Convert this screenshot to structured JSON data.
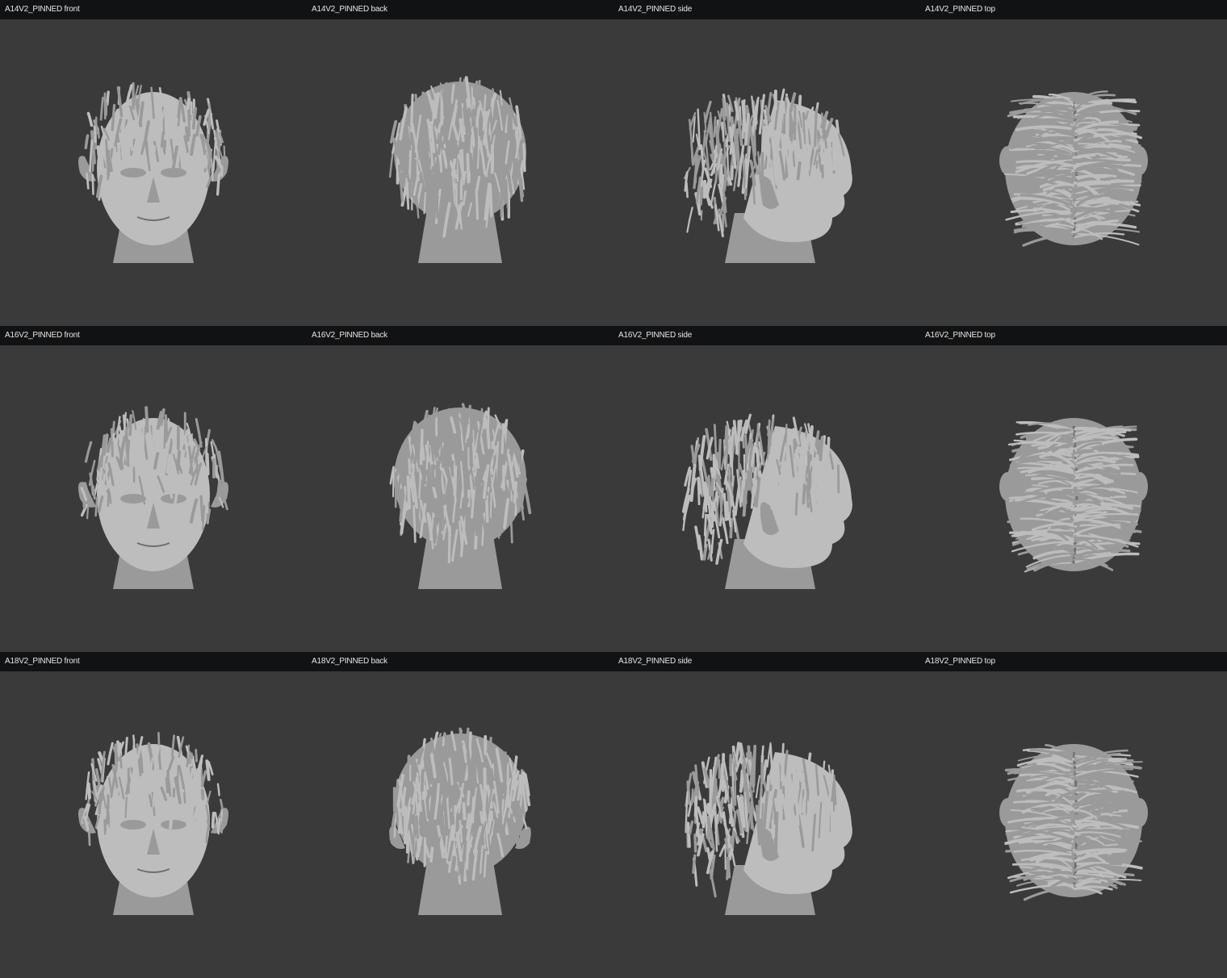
{
  "viewer": {
    "rows": [
      {
        "name": "A14V2_PINNED",
        "views": [
          {
            "label": "A14V2_PINNED front",
            "view": "front",
            "icon": "head-render-front"
          },
          {
            "label": "A14V2_PINNED back",
            "view": "back",
            "icon": "head-render-back"
          },
          {
            "label": "A14V2_PINNED side",
            "view": "side",
            "icon": "head-render-side"
          },
          {
            "label": "A14V2_PINNED top",
            "view": "top",
            "icon": "head-render-top"
          }
        ]
      },
      {
        "name": "A16V2_PINNED",
        "views": [
          {
            "label": "A16V2_PINNED front",
            "view": "front",
            "icon": "head-render-front"
          },
          {
            "label": "A16V2_PINNED back",
            "view": "back",
            "icon": "head-render-back"
          },
          {
            "label": "A16V2_PINNED side",
            "view": "side",
            "icon": "head-render-side"
          },
          {
            "label": "A16V2_PINNED top",
            "view": "top",
            "icon": "head-render-top"
          }
        ]
      },
      {
        "name": "A18V2_PINNED",
        "views": [
          {
            "label": "A18V2_PINNED front",
            "view": "front",
            "icon": "head-render-front"
          },
          {
            "label": "A18V2_PINNED back",
            "view": "back",
            "icon": "head-render-back"
          },
          {
            "label": "A18V2_PINNED side",
            "view": "side",
            "icon": "head-render-side"
          },
          {
            "label": "A18V2_PINNED top",
            "view": "top",
            "icon": "head-render-top"
          }
        ]
      }
    ]
  },
  "colors": {
    "background": "#3a3a3a",
    "header_bar": "#111214",
    "label_text": "#e6e6e6",
    "model_light": "#bdbdbd",
    "model_mid": "#9a9a9a",
    "model_dark": "#6e6e6e"
  }
}
